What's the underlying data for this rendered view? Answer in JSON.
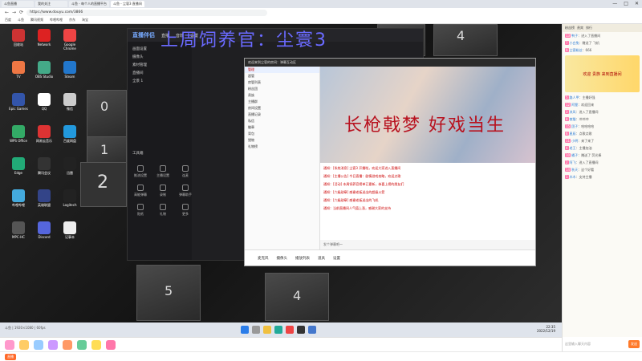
{
  "browser": {
    "tabs": [
      "斗鱼直播",
      "我的关注",
      "斗鱼 - 每个人的直播平台",
      "斗鱼 - 尘寰3 直播间"
    ],
    "address": "https://www.douyu.com/3866",
    "bookmarks": [
      "百度",
      "斗鱼",
      "腾讯视频",
      "哔哩哔哩",
      "京东",
      "淘宝"
    ],
    "window_buttons": [
      "—",
      "□",
      "✕"
    ]
  },
  "stream": {
    "overlay_title": "上周饲养官：尘寰3",
    "tile_numbers": [
      "1",
      "4",
      "0",
      "1",
      "2",
      "2",
      "5",
      "4"
    ],
    "desktop_icons": [
      "回收站",
      "Network",
      "Google Chrome",
      "TV",
      "OBS Studio",
      "Steam",
      "Epic Games",
      "QQ",
      "微信",
      "WPS Office",
      "网易云音乐",
      "百度网盘",
      "Edge",
      "腾讯会议",
      "迅雷",
      "哔哩哔哩",
      "英雄联盟",
      "Logitech",
      "MPC-HC",
      "Discord",
      "记事本"
    ]
  },
  "app": {
    "logo": "直播伴侣",
    "top_items": [
      "直播",
      "音效",
      "设置"
    ],
    "side_items": [
      "画面设置",
      "摄像头",
      "素材管理",
      "直播间",
      "全景 1"
    ],
    "tools_label": "工具箱",
    "tools": [
      "推流设置",
      "主播设置",
      "连麦",
      "高能弹幕",
      "录制",
      "弹幕助手",
      "贴纸",
      "礼物",
      "更多"
    ]
  },
  "chat": {
    "title": "欢迎来到尘寰的房间：弹幕互动区",
    "left_rows": [
      "管理",
      "超管",
      "房管列表",
      "粉丝团",
      "贵族",
      "主播群",
      "房间设置",
      "直播记录",
      "私信",
      "徽章",
      "背包",
      "猎物",
      "礼物榜"
    ],
    "banner_text": "长枪戟梦 好戏当生",
    "messages": [
      "通知：[系统消息] 尘寰3 开播啦，欢迎大家进入直播间",
      "通知：[主播公告] 今日直播：剧情游戏攻略，欢迎点歌",
      "通知：[活动] 本周饲养官榜单已更新，恭喜上榜的朋友们",
      "通知：[六级勋章] 感谢老板送出的超级火箭",
      "通知：[六级勋章] 感谢老板送出的飞机",
      "通知：当前直播间人气值上涨，感谢大家的支持"
    ],
    "input_placeholder": "发个弹幕吧～",
    "bottom": [
      "麦克风",
      "摄像头",
      "播放列表",
      "道具",
      "设置"
    ]
  },
  "rpanel": {
    "head": [
      "粉丝榜",
      "贵宾",
      "排行"
    ],
    "lines": [
      {
        "name": "鸭子",
        "text": "进入了直播间"
      },
      {
        "name": "小白兔",
        "text": "赠送了 飞机"
      },
      {
        "name": "尘寰粉丝",
        "text": "666"
      },
      {
        "name": "路人甲",
        "text": "主播好强"
      },
      {
        "name": "阿狸",
        "text": "欢迎回来"
      },
      {
        "name": "凉风",
        "text": "进入了直播间"
      },
      {
        "name": "夜猫",
        "text": "冲冲冲"
      },
      {
        "name": "团子",
        "text": "哈哈哈哈"
      },
      {
        "name": "星辰",
        "text": "点歌点歌"
      },
      {
        "name": "小明",
        "text": "来了来了"
      },
      {
        "name": "老王",
        "text": "主播加油"
      },
      {
        "name": "橘子",
        "text": "赠送了 荧光棒"
      },
      {
        "name": "阿飞",
        "text": "进入了直播间"
      },
      {
        "name": "秋天",
        "text": "这个好看"
      },
      {
        "name": "木木",
        "text": "支持主播"
      }
    ],
    "gift_banner": "欢迎 贵族 来到直播间"
  },
  "taskbar": {
    "status": "斗鱼 | 1920×1080 | 60fps",
    "time": "22:35",
    "date": "2022/12/19"
  },
  "bottom": {
    "chat_placeholder": "这里输入聊天内容",
    "send": "发送",
    "footer_button": "直播"
  },
  "colors": {
    "accent": "#ff6a2a",
    "title": "#6a6aff",
    "alert": "#c00000"
  }
}
